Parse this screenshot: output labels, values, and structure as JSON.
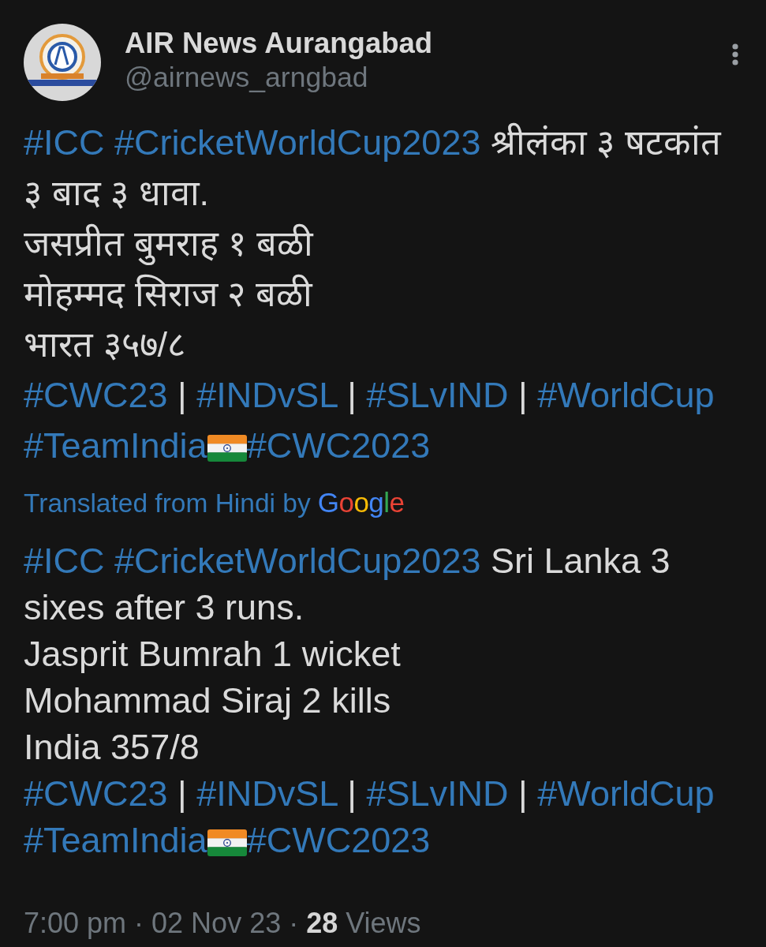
{
  "author": {
    "name": "AIR News Aurangabad",
    "handle": "@airnews_arngbad"
  },
  "original_text": [
    [
      {
        "kind": "hashtag",
        "text": "#ICC"
      },
      {
        "kind": "hashtag",
        "text": "#CricketWorldCup2023"
      },
      {
        "kind": "text",
        "text": "श्रीलंका ३ षटकांत"
      }
    ],
    [
      {
        "kind": "text",
        "text": "३ बाद ३ धावा."
      }
    ],
    [
      {
        "kind": "text",
        "text": "जसप्रीत बुमराह १ बळी"
      }
    ],
    [
      {
        "kind": "text",
        "text": "मोहम्मद सिराज २ बळी"
      }
    ],
    [
      {
        "kind": "text",
        "text": "भारत ३५७/८"
      }
    ],
    [
      {
        "kind": "hashtag",
        "text": "#CWC23"
      },
      {
        "kind": "text",
        "text": "|"
      },
      {
        "kind": "hashtag",
        "text": "#INDvSL"
      },
      {
        "kind": "text",
        "text": "|"
      },
      {
        "kind": "hashtag",
        "text": "#SLvIND"
      },
      {
        "kind": "text",
        "text": "|"
      },
      {
        "kind": "hashtag",
        "text": "#WorldCup"
      }
    ],
    [
      {
        "kind": "hashtag",
        "text": "#TeamIndia"
      },
      {
        "kind": "flag"
      },
      {
        "kind": "hashtag",
        "text": "#CWC2023"
      }
    ]
  ],
  "translation_credit": {
    "label": "Translated from Hindi by",
    "provider": "Google"
  },
  "translated_text": [
    [
      {
        "kind": "hashtag",
        "text": "#ICC"
      },
      {
        "kind": "hashtag",
        "text": "#CricketWorldCup2023"
      },
      {
        "kind": "text",
        "text": "Sri Lanka 3"
      }
    ],
    [
      {
        "kind": "text",
        "text": "sixes after 3 runs."
      }
    ],
    [
      {
        "kind": "text",
        "text": "Jasprit Bumrah 1 wicket"
      }
    ],
    [
      {
        "kind": "text",
        "text": "Mohammad Siraj 2 kills"
      }
    ],
    [
      {
        "kind": "text",
        "text": "India 357/8"
      }
    ],
    [
      {
        "kind": "hashtag",
        "text": "#CWC23"
      },
      {
        "kind": "text",
        "text": "|"
      },
      {
        "kind": "hashtag",
        "text": "#INDvSL"
      },
      {
        "kind": "text",
        "text": "|"
      },
      {
        "kind": "hashtag",
        "text": "#SLvIND"
      },
      {
        "kind": "text",
        "text": "|"
      },
      {
        "kind": "hashtag",
        "text": "#WorldCup"
      }
    ],
    [
      {
        "kind": "hashtag",
        "text": "#TeamIndia"
      },
      {
        "kind": "flag"
      },
      {
        "kind": "hashtag",
        "text": "#CWC2023"
      }
    ]
  ],
  "footer": "7:00 pm · 02 Nov 23 · **28** Views"
}
